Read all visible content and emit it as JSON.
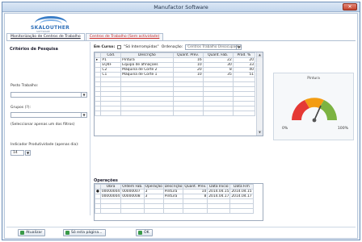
{
  "window": {
    "title": "Manufactor Software",
    "close_glyph": "✕"
  },
  "logo": {
    "text": "SKALOUTHER",
    "sub": "SOFTWARE"
  },
  "tabs": [
    {
      "label": "Monitorização de Centros de Trabalho"
    },
    {
      "label": "Centros de Trabalho (Sem actividade)"
    }
  ],
  "filters": {
    "title": "Critérios de Pesquisa",
    "posto_label": "Posto Trabalho:",
    "grupo_label": "Grupos (?):",
    "seleccionar_label": "(Seleccionar apenas um dos filtros)",
    "indicador_label": "Indicador Produtividade (apenas dia):",
    "indicador_value": "14"
  },
  "center": {
    "em_curso_label": "Em Curso:",
    "inter_label": "\"Só Interrompidas\"",
    "ordenacao_label": "Ordenação:",
    "ordenacao_value": "Centros Trabalho Desocupados",
    "columns": [
      "Cód.",
      "Descrição",
      "Quant. Prev.",
      "Quant. Fab.",
      "Prod. %"
    ],
    "rows": [
      [
        "P1",
        "Pintura",
        "16",
        "22",
        "20"
      ],
      [
        "EQ4F",
        "Equipa de afinações",
        "10",
        "30",
        "33"
      ],
      [
        "C2",
        "Máquina de Corte 2",
        "20",
        "8",
        "40"
      ],
      [
        "C1",
        "Máquina de Corte 1",
        "10",
        "35",
        "51"
      ]
    ]
  },
  "gauge": {
    "title": "Pintura",
    "min_label": "0%",
    "max_label": "100%"
  },
  "operacoes": {
    "title": "Operações",
    "columns": [
      "",
      "Obra",
      "Ordem Fab.",
      "Operação",
      "Descrição",
      "Quant. Prev.",
      "Data Inicio",
      "Data Fim"
    ],
    "rows": [
      [
        "●",
        "00000004",
        "00000007",
        "3",
        "Pintura",
        "10",
        "2014.04.15",
        "2014.04.15"
      ],
      [
        "",
        "00000004",
        "00000008",
        "3",
        "Pintura",
        "8",
        "2014.04.17",
        "2014.04.17"
      ]
    ]
  },
  "buttons": {
    "atualizar": "Atualizar",
    "so_esta_pagina": "Só esta página...",
    "ok": "OK"
  },
  "colors": {
    "accent": "#2e6fb8",
    "gauge_red": "#e53935",
    "gauge_orange": "#f39c12",
    "gauge_green": "#7cb342",
    "tab_red": "#c62828"
  }
}
